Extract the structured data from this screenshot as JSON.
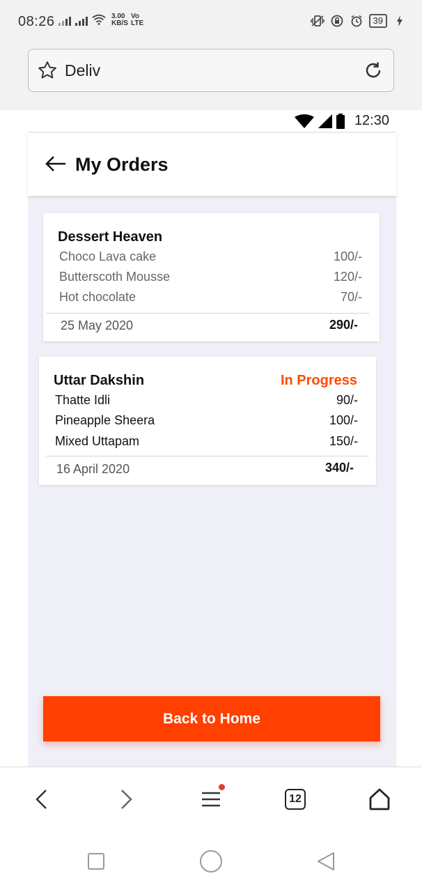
{
  "system_status": {
    "time": "08:26",
    "net_speed": "3.00\nKB/S",
    "net_type": "Vo\nLTE",
    "battery": "39"
  },
  "browser": {
    "url_text": "Deliv"
  },
  "app": {
    "status_time": "12:30",
    "title": "My Orders",
    "orders": [
      {
        "restaurant": "Dessert Heaven",
        "status": "",
        "items": [
          {
            "name": "Choco Lava cake",
            "price": "100/-"
          },
          {
            "name": "Butterscoth Mousse",
            "price": "120/-"
          },
          {
            "name": "Hot chocolate",
            "price": "70/-"
          }
        ],
        "date": "25 May 2020",
        "total": "290/-"
      },
      {
        "restaurant": "Uttar Dakshin",
        "status": "In Progress",
        "items": [
          {
            "name": "Thatte Idli",
            "price": "90/-"
          },
          {
            "name": "Pineapple Sheera",
            "price": "100/-"
          },
          {
            "name": "Mixed Uttapam",
            "price": "150/-"
          }
        ],
        "date": "16 April 2020",
        "total": "340/-"
      }
    ],
    "back_home_label": "Back to Home"
  },
  "toolbar": {
    "tab_count": "12"
  },
  "colors": {
    "accent": "#ff4000",
    "status_in_progress": "#ff4a00",
    "content_bg": "#efeff7"
  }
}
